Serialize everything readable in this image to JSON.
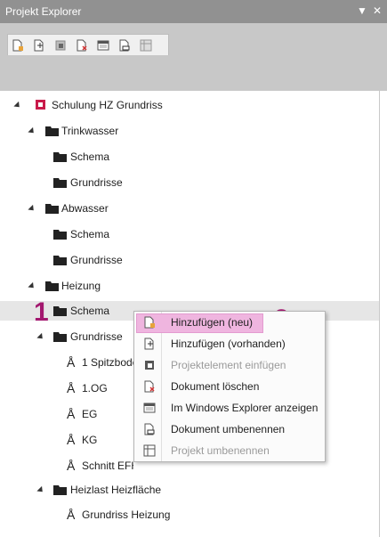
{
  "panel": {
    "title": "Projekt Explorer",
    "pin_icon": "pin-icon",
    "close_icon": "close-icon"
  },
  "toolbar": {
    "icons": [
      "add-document-icon",
      "add-existing-icon",
      "insert-element-icon",
      "delete-document-icon",
      "explorer-icon",
      "rename-document-icon",
      "rename-project-icon"
    ]
  },
  "tree": {
    "root": "Schulung HZ Grundriss",
    "trinkwasser": "Trinkwasser",
    "tw_schema": "Schema",
    "tw_grundrisse": "Grundrisse",
    "abwasser": "Abwasser",
    "aw_schema": "Schema",
    "aw_grundrisse": "Grundrisse",
    "heizung": "Heizung",
    "hz_schema": "Schema",
    "hz_grundrisse": "Grundrisse",
    "g1": "1 Spitzboden",
    "g2": "1.OG",
    "g3": "EG",
    "g4": "KG",
    "g5": "Schnitt EFH",
    "heizlast": "Heizlast Heizfläche",
    "hl_grundriss": "Grundriss Heizung"
  },
  "context_menu": {
    "items": [
      {
        "label": "Hinzufügen (neu)",
        "icon": "add-document-icon",
        "enabled": true
      },
      {
        "label": "Hinzufügen (vorhanden)",
        "icon": "add-existing-icon",
        "enabled": true
      },
      {
        "label": "Projektelement einfügen",
        "icon": "insert-element-icon",
        "enabled": false
      },
      {
        "label": "Dokument löschen",
        "icon": "delete-document-icon",
        "enabled": true
      },
      {
        "label": "Im Windows Explorer anzeigen",
        "icon": "explorer-icon",
        "enabled": true
      },
      {
        "label": "Dokument umbenennen",
        "icon": "rename-document-icon",
        "enabled": true
      },
      {
        "label": "Projekt umbenennen",
        "icon": "rename-project-icon",
        "enabled": false
      }
    ]
  },
  "annotations": {
    "step1": "1",
    "step2": "2"
  },
  "colors": {
    "accent": "#a3186f",
    "highlight": "#efb5df",
    "titlebar": "#919191"
  }
}
